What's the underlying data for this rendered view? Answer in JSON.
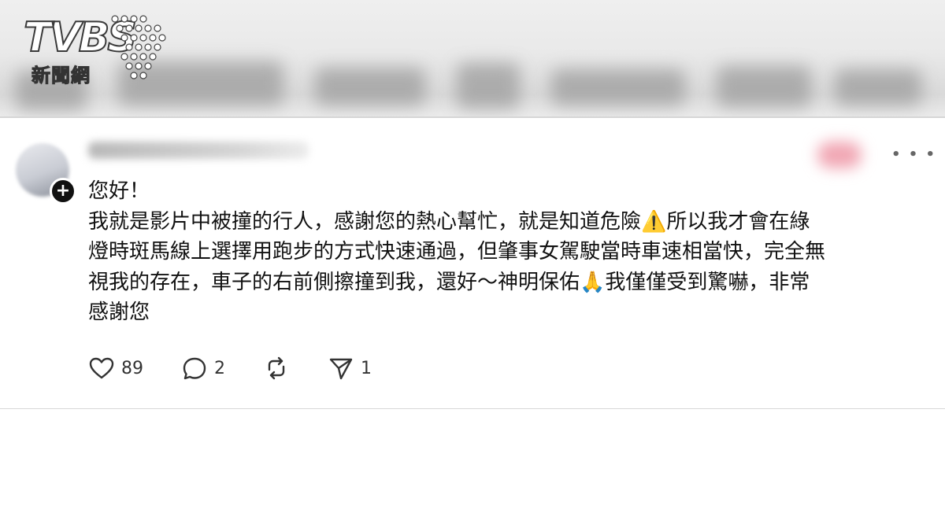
{
  "logo": {
    "brand": "TVBS",
    "subtitle": "新聞網"
  },
  "comment": {
    "lines": [
      "您好！",
      "我就是影片中被撞的行人，感謝您的熱心幫忙，就是知道危險⚠️所以我才會在綠",
      "燈時斑馬線上選擇用跑步的方式快速通過，但肇事女駕駛當時車速相當快，完全無",
      "視我的存在，車子的右前側擦撞到我，還好～神明保佑🙏我僅僅受到驚嚇，非常",
      "感謝您"
    ]
  },
  "actions": {
    "like_icon": "heart-icon",
    "like_count": "89",
    "comment_icon": "comment-bubble-icon",
    "comment_count": "2",
    "repost_icon": "repost-icon",
    "share_icon": "send-icon",
    "share_count": "1"
  },
  "menu_icon": "more-options-icon"
}
